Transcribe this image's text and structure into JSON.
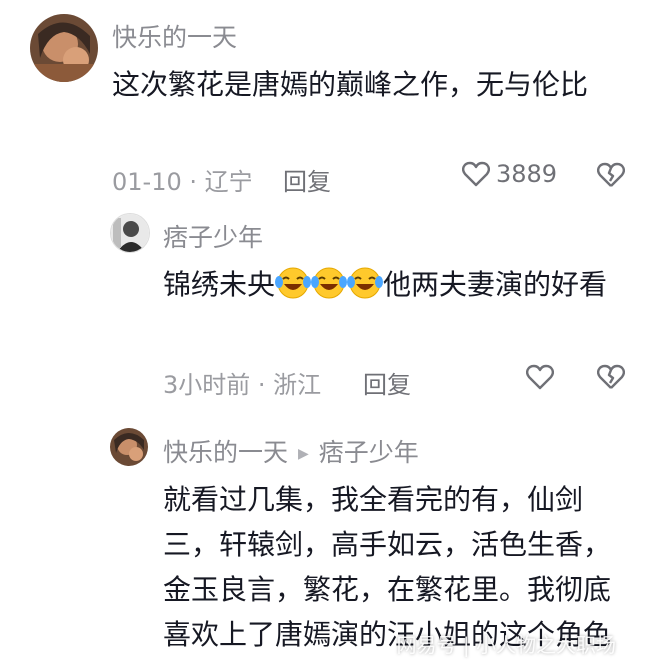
{
  "comments": [
    {
      "username": "快乐的一天",
      "text": "这次繁花是唐嫣的巅峰之作，无与伦比",
      "date_location": "01-10 · 辽宁",
      "reply_label": "回复",
      "like_count": "3889",
      "avatar_icon": "avatar-photo"
    },
    {
      "username": "痞子少年",
      "text_before_emoji": "锦绣未央",
      "emoji_name": "laughing-crying-emoji",
      "emoji_count": 3,
      "text_after_emoji": "他两夫妻演的好看",
      "date_location": "3小时前 · 浙江",
      "reply_label": "回复",
      "avatar_icon": "avatar-photo"
    },
    {
      "username": "快乐的一天",
      "reply_to": "痞子少年",
      "text": "就看过几集，我全看完的有，仙剑三，轩辕剑，高手如云，活色生香，金玉良言，繁花，在繁花里。我彻底喜欢上了唐嫣演的汪小姐的这个角色",
      "avatar_icon": "avatar-photo"
    }
  ],
  "icons": {
    "like": "heart-outline-icon",
    "dislike": "broken-heart-icon",
    "reply_arrow": "triangle-right-icon"
  },
  "watermark": "网易号 | 小人物之大职场",
  "colors": {
    "text": "#161823",
    "username": "#8a8b91",
    "meta": "#9a9ba0"
  }
}
